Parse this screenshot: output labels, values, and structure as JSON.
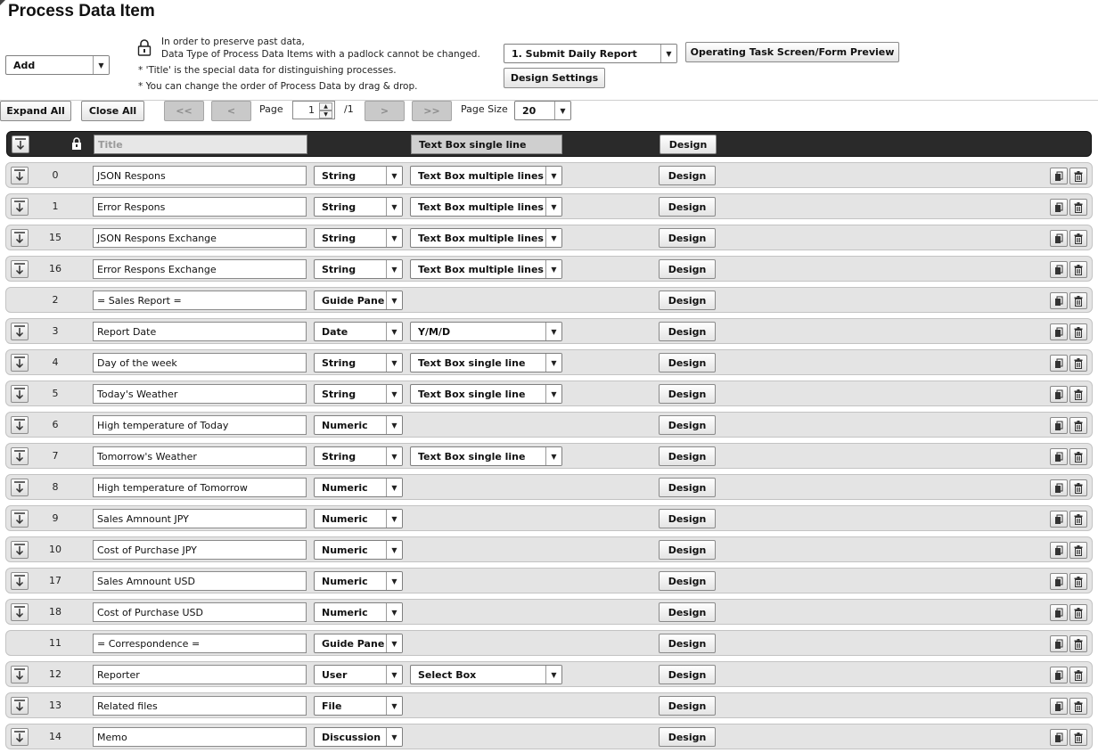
{
  "page": {
    "title": "Process Data Item"
  },
  "top": {
    "add_label": "Add",
    "notes": [
      "In order to preserve past data,",
      "Data Type of Process Data Items with a padlock cannot be changed.",
      "* 'Title' is the special data for distinguishing processes.",
      "* You can change the order of Process Data by drag & drop."
    ],
    "process_select": "1. Submit Daily Report",
    "preview_button": "Operating Task Screen/Form Preview",
    "design_settings_button": "Design Settings"
  },
  "toolbar": {
    "expand_all": "Expand All",
    "close_all": "Close All",
    "first": "<<",
    "prev": "<",
    "page_label": "Page",
    "page_value": "1",
    "page_total": "/1",
    "next": ">",
    "last": ">>",
    "page_size_label": "Page Size",
    "page_size_value": "20"
  },
  "header_row": {
    "title_placeholder": "Title",
    "form_type": "Text Box single line",
    "design": "Design"
  },
  "rows": [
    {
      "num": "0",
      "name": "JSON Respons",
      "type": "String",
      "form": "Text Box multiple lines",
      "draggable": true,
      "design": "Design"
    },
    {
      "num": "1",
      "name": "Error Respons",
      "type": "String",
      "form": "Text Box multiple lines",
      "draggable": true,
      "design": "Design"
    },
    {
      "num": "15",
      "name": "JSON Respons Exchange",
      "type": "String",
      "form": "Text Box multiple lines",
      "draggable": true,
      "design": "Design"
    },
    {
      "num": "16",
      "name": "Error Respons Exchange",
      "type": "String",
      "form": "Text Box multiple lines",
      "draggable": true,
      "design": "Design"
    },
    {
      "num": "2",
      "name": "= Sales Report =",
      "type": "Guide Pane",
      "form": "",
      "draggable": false,
      "design": "Design"
    },
    {
      "num": "3",
      "name": "Report Date",
      "type": "Date",
      "form": "Y/M/D",
      "draggable": true,
      "design": "Design"
    },
    {
      "num": "4",
      "name": "Day of the week",
      "type": "String",
      "form": "Text Box single line",
      "draggable": true,
      "design": "Design"
    },
    {
      "num": "5",
      "name": "Today's Weather",
      "type": "String",
      "form": "Text Box single line",
      "draggable": true,
      "design": "Design"
    },
    {
      "num": "6",
      "name": "High temperature of Today",
      "type": "Numeric",
      "form": "",
      "draggable": true,
      "design": "Design"
    },
    {
      "num": "7",
      "name": "Tomorrow's Weather",
      "type": "String",
      "form": "Text Box single line",
      "draggable": true,
      "design": "Design"
    },
    {
      "num": "8",
      "name": "High temperature of Tomorrow",
      "type": "Numeric",
      "form": "",
      "draggable": true,
      "design": "Design"
    },
    {
      "num": "9",
      "name": "Sales Amnount JPY",
      "type": "Numeric",
      "form": "",
      "draggable": true,
      "design": "Design"
    },
    {
      "num": "10",
      "name": "Cost of Purchase JPY",
      "type": "Numeric",
      "form": "",
      "draggable": true,
      "design": "Design"
    },
    {
      "num": "17",
      "name": "Sales Amnount USD",
      "type": "Numeric",
      "form": "",
      "draggable": true,
      "design": "Design"
    },
    {
      "num": "18",
      "name": "Cost of Purchase USD",
      "type": "Numeric",
      "form": "",
      "draggable": true,
      "design": "Design"
    },
    {
      "num": "11",
      "name": "= Correspondence =",
      "type": "Guide Pane",
      "form": "",
      "draggable": false,
      "design": "Design"
    },
    {
      "num": "12",
      "name": "Reporter",
      "type": "User",
      "form": "Select Box",
      "draggable": true,
      "design": "Design"
    },
    {
      "num": "13",
      "name": "Related files",
      "type": "File",
      "form": "",
      "draggable": true,
      "design": "Design"
    },
    {
      "num": "14",
      "name": "Memo",
      "type": "Discussion",
      "form": "",
      "draggable": true,
      "design": "Design"
    }
  ]
}
